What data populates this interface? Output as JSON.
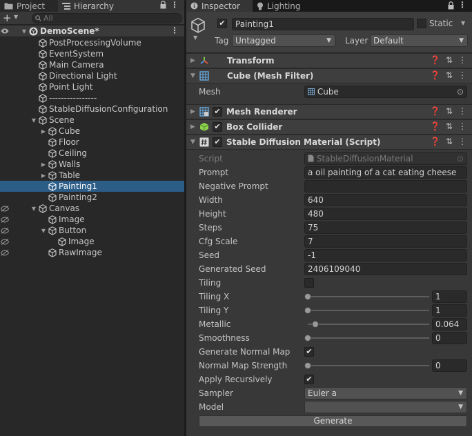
{
  "left_tabs": {
    "project": "Project",
    "hierarchy": "Hierarchy"
  },
  "search": {
    "placeholder": "All"
  },
  "hierarchy": {
    "scene": "DemoScene*",
    "items": [
      {
        "label": "PostProcessingVolume",
        "depth": 1,
        "expand": false
      },
      {
        "label": "EventSystem",
        "depth": 1,
        "expand": false
      },
      {
        "label": "Main Camera",
        "depth": 1,
        "expand": false
      },
      {
        "label": "Directional Light",
        "depth": 1,
        "expand": false
      },
      {
        "label": "Point Light",
        "depth": 1,
        "expand": false
      },
      {
        "label": "----------------",
        "depth": 1,
        "expand": false
      },
      {
        "label": "StableDiffusionConfiguration",
        "depth": 1,
        "expand": false
      },
      {
        "label": "Scene",
        "depth": 1,
        "expand": "open"
      },
      {
        "label": "Cube",
        "depth": 2,
        "expand": "closed"
      },
      {
        "label": "Floor",
        "depth": 2,
        "expand": false
      },
      {
        "label": "Ceiling",
        "depth": 2,
        "expand": false
      },
      {
        "label": "Walls",
        "depth": 2,
        "expand": "closed"
      },
      {
        "label": "Table",
        "depth": 2,
        "expand": "closed"
      },
      {
        "label": "Painting1",
        "depth": 2,
        "expand": false,
        "selected": true
      },
      {
        "label": "Painting2",
        "depth": 2,
        "expand": false
      },
      {
        "label": "Canvas",
        "depth": 1,
        "expand": "open",
        "hidden": true
      },
      {
        "label": "Image",
        "depth": 2,
        "expand": false,
        "hidden": true
      },
      {
        "label": "Button",
        "depth": 2,
        "expand": "open",
        "hidden": true
      },
      {
        "label": "Image",
        "depth": 3,
        "expand": false,
        "hidden": true
      },
      {
        "label": "RawImage",
        "depth": 2,
        "expand": false,
        "hidden": true
      }
    ]
  },
  "right_tabs": {
    "inspector": "Inspector",
    "lighting": "Lighting"
  },
  "object": {
    "name": "Painting1",
    "static_label": "Static",
    "tag_label": "Tag",
    "tag_value": "Untagged",
    "layer_label": "Layer",
    "layer_value": "Default"
  },
  "components": {
    "transform": "Transform",
    "mesh_filter": "Cube (Mesh Filter)",
    "mesh_label": "Mesh",
    "mesh_value": "Cube",
    "mesh_renderer": "Mesh Renderer",
    "box_collider": "Box Collider",
    "sd_material": "Stable Diffusion Material (Script)"
  },
  "props": {
    "script_label": "Script",
    "script_value": "StableDiffusionMaterial",
    "prompt_label": "Prompt",
    "prompt_value": "a oil painting of a cat eating cheese",
    "neg_prompt_label": "Negative Prompt",
    "neg_prompt_value": "",
    "width_label": "Width",
    "width_value": "640",
    "height_label": "Height",
    "height_value": "480",
    "steps_label": "Steps",
    "steps_value": "75",
    "cfg_label": "Cfg Scale",
    "cfg_value": "7",
    "seed_label": "Seed",
    "seed_value": "-1",
    "gen_seed_label": "Generated Seed",
    "gen_seed_value": "2406109040",
    "tiling_label": "Tiling",
    "tiling_x_label": "Tiling X",
    "tiling_x_value": "1",
    "tiling_y_label": "Tiling Y",
    "tiling_y_value": "1",
    "metallic_label": "Metallic",
    "metallic_value": "0.064",
    "smoothness_label": "Smoothness",
    "smoothness_value": "0",
    "gen_normal_label": "Generate Normal Map",
    "normal_strength_label": "Normal Map Strength",
    "normal_strength_value": "0",
    "apply_rec_label": "Apply Recursively",
    "sampler_label": "Sampler",
    "sampler_value": "Euler a",
    "model_label": "Model",
    "model_value": "",
    "generate_label": "Generate"
  },
  "sliders": {
    "tiling_x": 0.0,
    "tiling_y": 0.0,
    "metallic": 0.064,
    "smoothness": 0.0,
    "normal_strength": 0.0
  },
  "colors": {
    "selection": "#2c5d87",
    "panel": "#383838",
    "header": "#3e3e3e",
    "field": "#2a2a2a"
  }
}
